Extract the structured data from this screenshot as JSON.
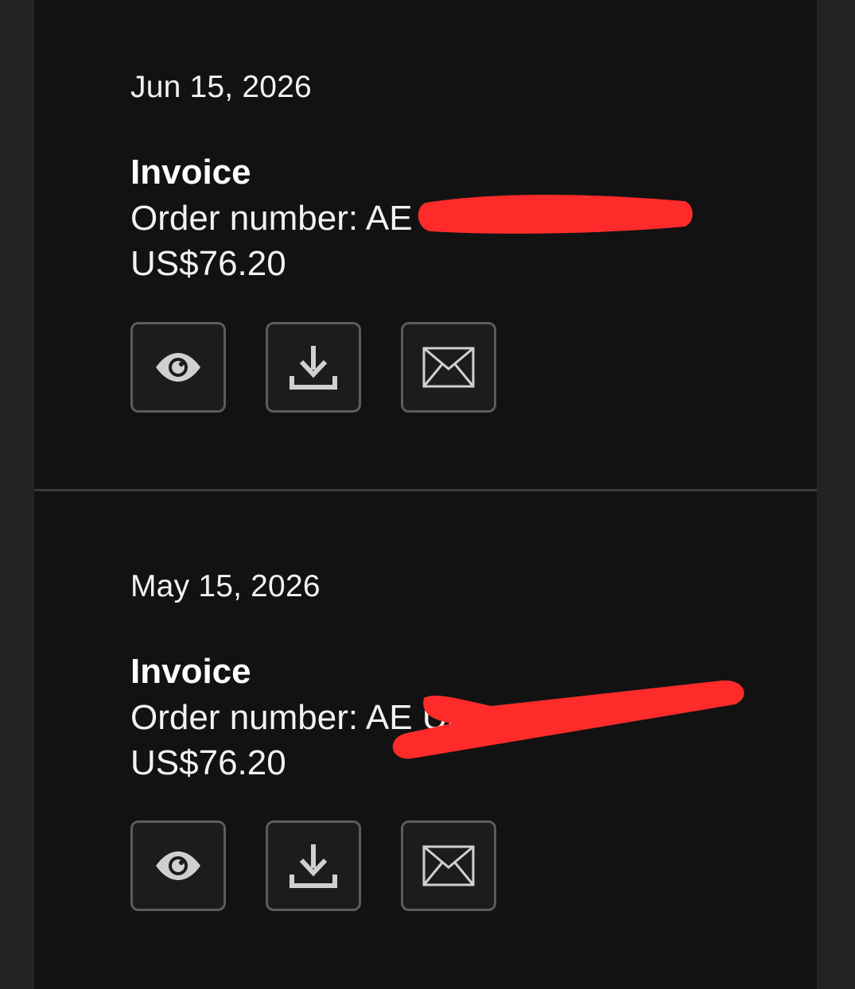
{
  "invoices": [
    {
      "date": "Jun 15, 2026",
      "title": "Invoice",
      "order_number": "Order number: AE                                S",
      "amount": "US$76.20"
    },
    {
      "date": "May 15, 2026",
      "title": "Invoice",
      "order_number": "Order number: AE                                US",
      "amount": "US$76.20"
    }
  ],
  "icons": {
    "view": "eye-icon",
    "download": "download-icon",
    "email": "envelope-icon"
  },
  "colors": {
    "background": "#121212",
    "icon": "#d0d0d0",
    "redaction": "#ff2b2b"
  }
}
